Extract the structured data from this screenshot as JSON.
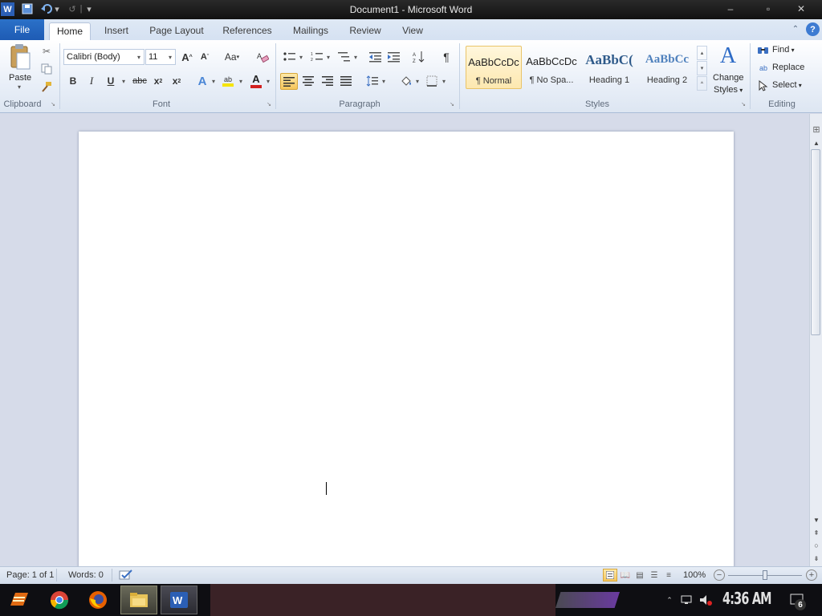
{
  "window": {
    "title": "Document1 - Microsoft Word",
    "minimize": "–",
    "maximize": "▫",
    "close": "✕"
  },
  "tabs": {
    "file": "File",
    "items": [
      "Home",
      "Insert",
      "Page Layout",
      "References",
      "Mailings",
      "Review",
      "View"
    ]
  },
  "ribbon": {
    "clipboard": {
      "paste_label": "Paste",
      "group_label": "Clipboard"
    },
    "font": {
      "font_name": "Calibri (Body)",
      "font_size": "11",
      "grow_label": "A",
      "shrink_label": "A",
      "case_label": "Aa",
      "bold": "B",
      "italic": "I",
      "underline": "U",
      "strike": "abc",
      "subscript": "x",
      "superscript": "x",
      "group_label": "Font"
    },
    "paragraph": {
      "group_label": "Paragraph"
    },
    "styles": {
      "items": [
        {
          "sample": "AaBbCcDc",
          "name": "¶ Normal"
        },
        {
          "sample": "AaBbCcDc",
          "name": "¶ No Spa..."
        },
        {
          "sample": "AaBbC(",
          "name": "Heading 1"
        },
        {
          "sample": "AaBbCc",
          "name": "Heading 2"
        }
      ],
      "change_styles_line1": "Change",
      "change_styles_line2": "Styles",
      "group_label": "Styles"
    },
    "editing": {
      "find": "Find",
      "replace": "Replace",
      "select": "Select",
      "group_label": "Editing"
    }
  },
  "status": {
    "page": "Page: 1 of 1",
    "words": "Words: 0",
    "zoom": "100%",
    "zoom_level": 1.0
  },
  "taskbar": {
    "clock": "4:36 AM",
    "notification_count": "6"
  },
  "colors": {
    "file_tab": "#2b71c8",
    "ribbon_bg": "#e9eff8",
    "font_color_bar": "#d22020",
    "highlight_bar": "#f5e400",
    "selected_style_border": "#e9c46a"
  },
  "icons": [
    "word-app-icon",
    "save-icon",
    "undo-icon",
    "redo-icon",
    "customize-qat-icon",
    "help-icon",
    "minimize-ribbon-icon",
    "cut-icon",
    "copy-icon",
    "format-painter-icon",
    "bullets-icon",
    "numbering-icon",
    "multilevel-list-icon",
    "decrease-indent-icon",
    "increase-indent-icon",
    "sort-icon",
    "show-marks-icon",
    "align-left-icon",
    "center-icon",
    "align-right-icon",
    "justify-icon",
    "line-spacing-icon",
    "shading-icon",
    "borders-icon",
    "find-icon",
    "replace-icon",
    "select-icon",
    "proofing-icon",
    "start-icon",
    "chrome-icon",
    "firefox-icon",
    "explorer-icon",
    "word-task-icon",
    "network-icon",
    "volume-icon"
  ]
}
